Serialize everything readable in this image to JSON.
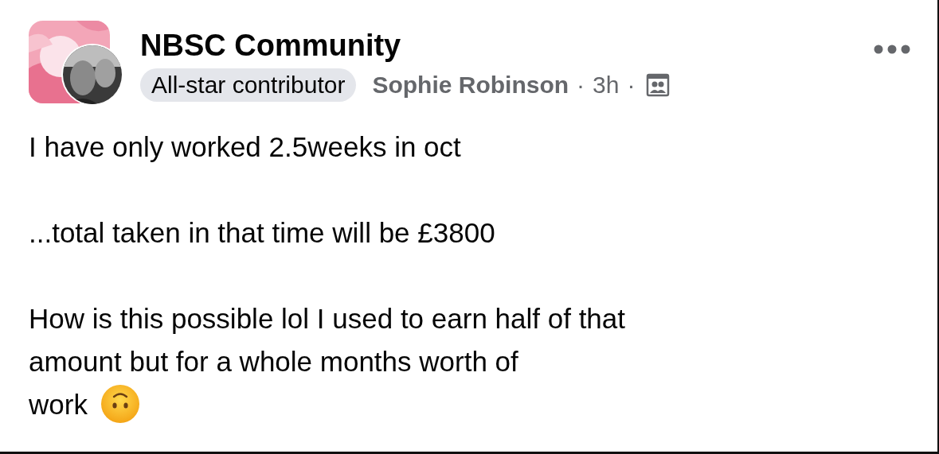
{
  "post": {
    "group": "NBSC Community",
    "badge": "All-star contributor",
    "author": "Sophie Robinson",
    "separator": "·",
    "time": "3h",
    "paragraphs": [
      {
        "lines": [
          "I have only worked 2.5weeks in oct"
        ]
      },
      {
        "lines": [
          "...total taken in that time will be £3800"
        ]
      },
      {
        "lines": [
          "How is this possible lol I used to earn half of that",
          "amount but for a whole months worth of",
          "work"
        ],
        "emoji": true
      }
    ]
  }
}
